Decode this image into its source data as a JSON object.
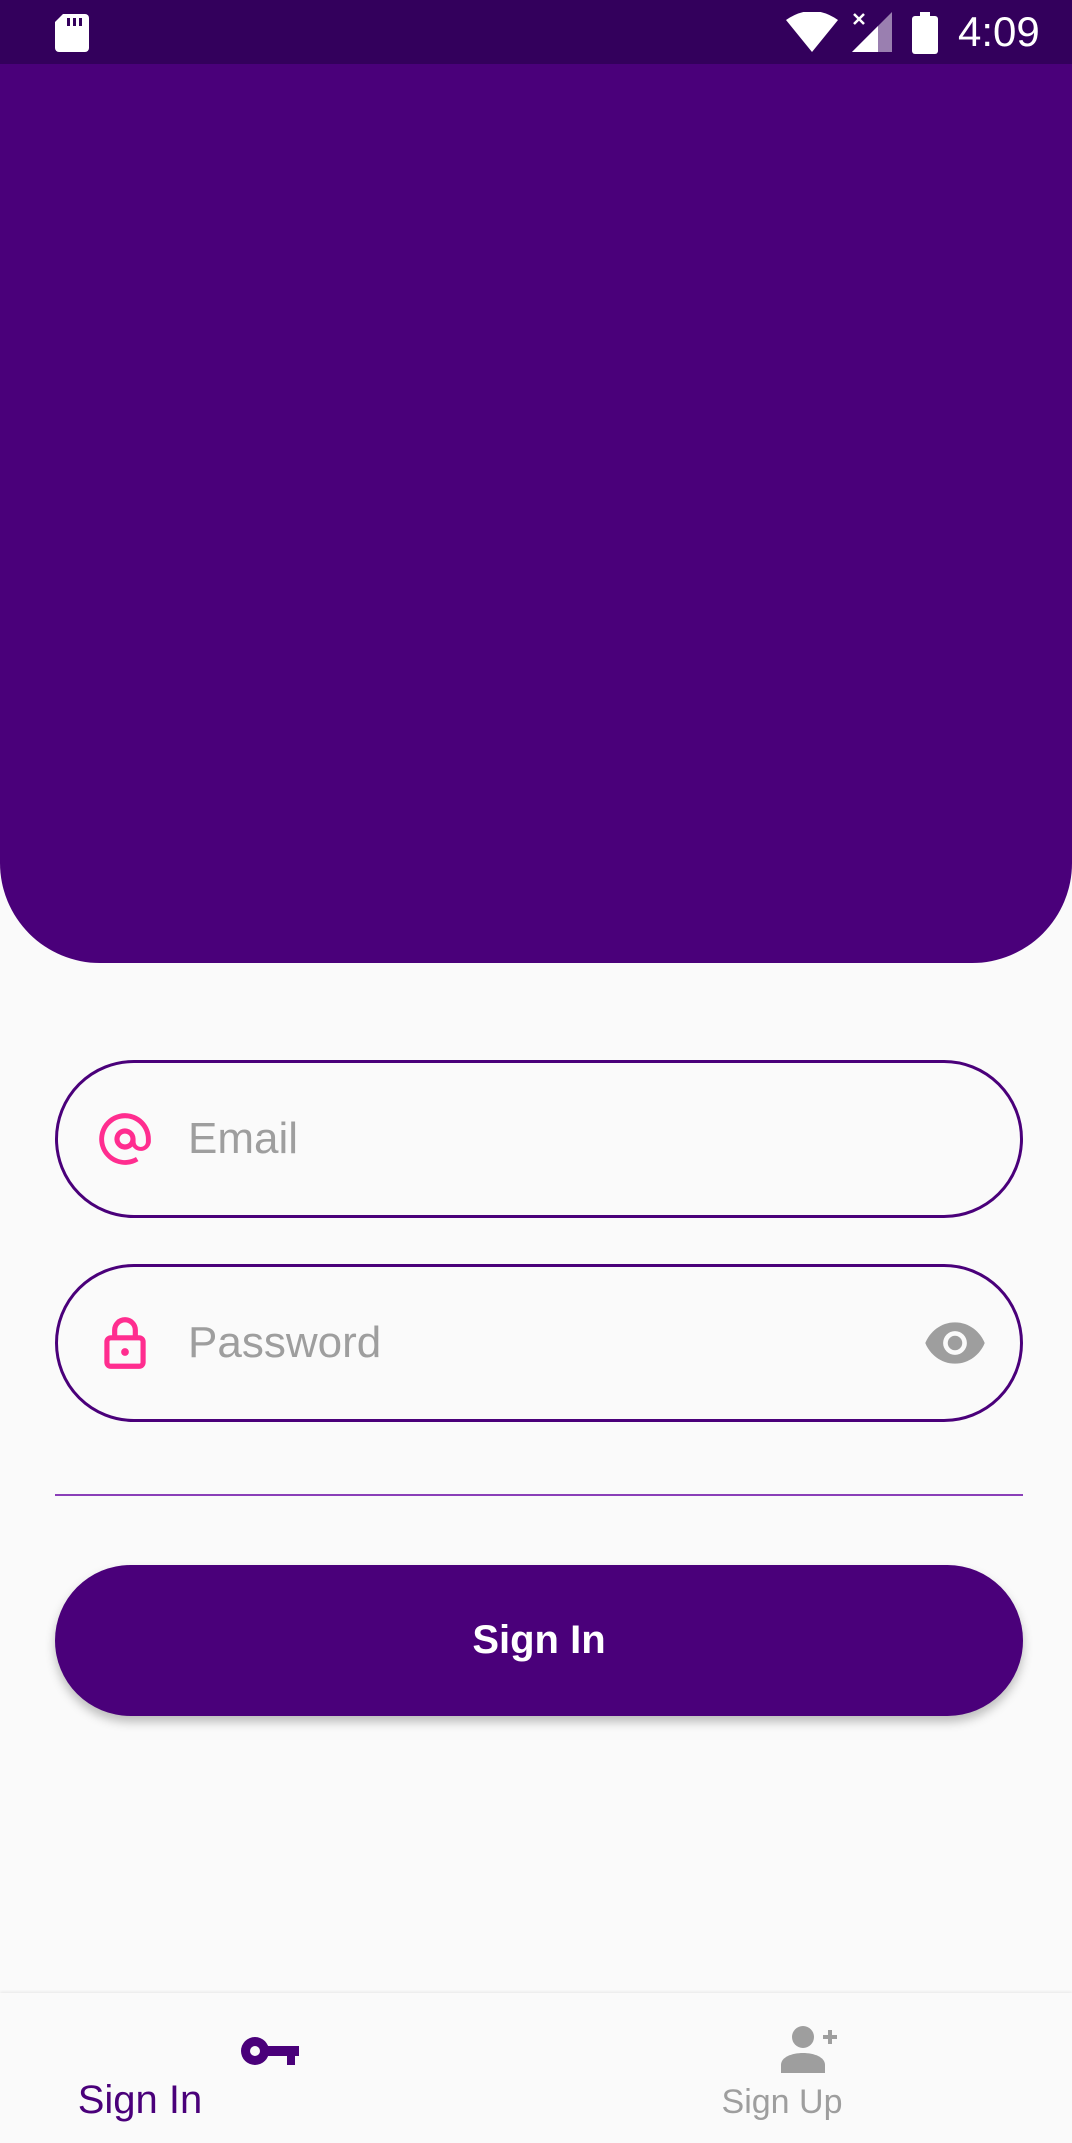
{
  "status_bar": {
    "time": "4:09"
  },
  "form": {
    "email": {
      "value": "",
      "placeholder": "Email"
    },
    "password": {
      "value": "",
      "placeholder": "Password"
    },
    "submit_label": "Sign In"
  },
  "bottom_nav": {
    "items": [
      {
        "label": "Sign In",
        "icon": "key-icon",
        "active": true
      },
      {
        "label": "Sign Up",
        "icon": "person-add-icon",
        "active": false
      }
    ]
  },
  "colors": {
    "primary": "#4a007a",
    "status_bar": "#33005c",
    "accent_icon": "#ff2d8f",
    "inactive": "#9e9e9e",
    "background": "#fafafa"
  }
}
